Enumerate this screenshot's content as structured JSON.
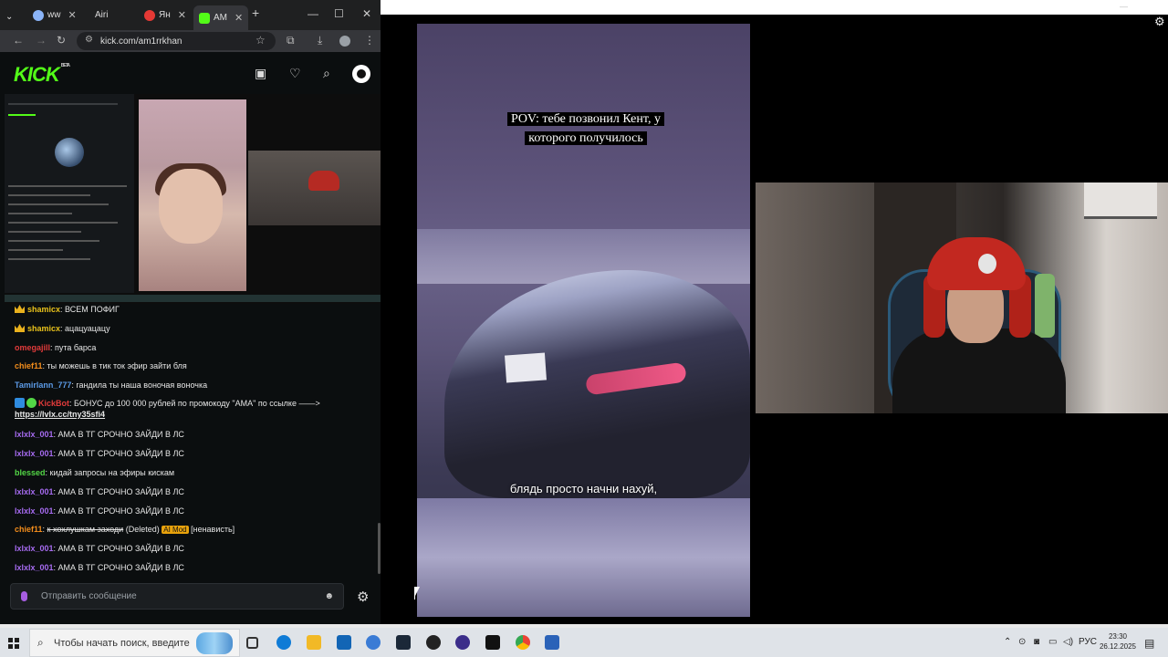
{
  "browser": {
    "tabs": [
      {
        "label": "ww",
        "color": "#8ab4f8"
      },
      {
        "label": "Airi",
        "color": "#3a8ee6"
      },
      {
        "label": "Ян",
        "color": "#e53935"
      },
      {
        "label": "АМ",
        "color": "#53fc18"
      }
    ],
    "url": "kick.com/am1rrkhan"
  },
  "kick": {
    "logo": "KICK",
    "beta": "BETA"
  },
  "chat": {
    "messages": [
      {
        "user": "shamicx",
        "color": "#e9c21b",
        "badge": "crown",
        "text": ": ВСЕМ ПОФИГ"
      },
      {
        "user": "shamicx",
        "color": "#e9c21b",
        "badge": "crown",
        "text": ": ацацуацацу"
      },
      {
        "user": "omegajill",
        "color": "#e23b3b",
        "badge": "",
        "text": ": пута барса"
      },
      {
        "user": "chief11",
        "color": "#f38d1c",
        "badge": "",
        "text": ": ты можешь в тик ток эфир зайти бля"
      },
      {
        "user": "Tamirlann_777",
        "color": "#5b9ae6",
        "badge": "",
        "text": ": гандила ты наша воночая воночка"
      },
      {
        "user": "KickBot",
        "color": "#e23b3b",
        "badge": "bot",
        "text": ": БОНУС до 100 000 рублей по промокоду \"АМА\" по ссылке ——>",
        "link": "https://lvlx.cc/tny35sfi4"
      },
      {
        "user": "lxlxlx_001",
        "color": "#a66bf0",
        "badge": "",
        "text": ": АМА В ТГ СРОЧНО ЗАЙДИ В ЛС"
      },
      {
        "user": "lxlxlx_001",
        "color": "#a66bf0",
        "badge": "",
        "text": ": АМА В ТГ СРОЧНО ЗАЙДИ В ЛС"
      },
      {
        "user": "blessed",
        "color": "#53d646",
        "badge": "",
        "text": ": кидай запросы на эфиры кискам"
      },
      {
        "user": "lxlxlx_001",
        "color": "#a66bf0",
        "badge": "",
        "text": ": АМА В ТГ СРОЧНО ЗАЙДИ В ЛС"
      },
      {
        "user": "lxlxlx_001",
        "color": "#a66bf0",
        "badge": "",
        "text": ": АМА В ТГ СРОЧНО ЗАЙДИ В ЛС"
      },
      {
        "user": "chief11",
        "color": "#f38d1c",
        "badge": "",
        "text": ": к хохлушкам заходи",
        "deleted": "(Deleted)",
        "mod": "AI Mod",
        "reason": "[ненависть]"
      },
      {
        "user": "lxlxlx_001",
        "color": "#a66bf0",
        "badge": "",
        "text": ": АМА В ТГ СРОЧНО ЗАЙДИ В ЛС"
      },
      {
        "user": "lxlxlx_001",
        "color": "#a66bf0",
        "badge": "",
        "text": ": АМА В ТГ СРОЧНО ЗАЙДИ В ЛС"
      }
    ],
    "input_placeholder": "Отправить сообщение"
  },
  "video": {
    "caption_top": "POV: тебе позвонил Кент, у которого получилось",
    "caption_bottom": "блядь просто начни нахуй,"
  },
  "taskbar": {
    "search_text": "Чтобы начать поиск, введите",
    "lang": "РУС",
    "time": "23:30",
    "date": "26.12.2025"
  }
}
